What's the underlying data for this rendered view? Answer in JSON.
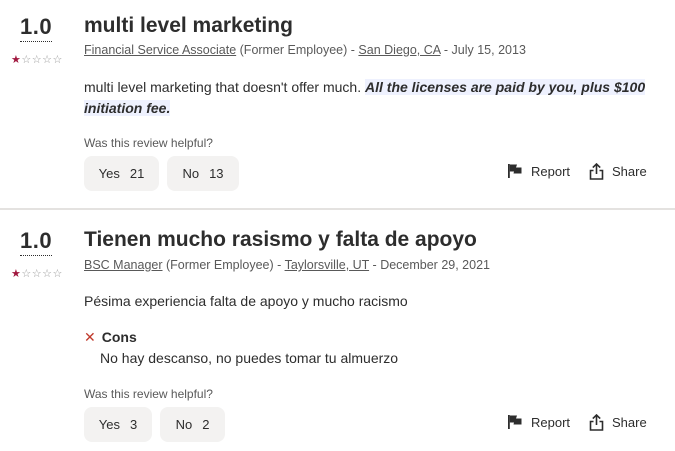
{
  "reviews": [
    {
      "rating": "1.0",
      "stars": 1,
      "title": "multi level marketing",
      "job_title": "Financial Service Associate",
      "employment": "(Former Employee)",
      "location": "San Diego, CA",
      "date": "July 15, 2013",
      "sep1": " - ",
      "sep2": " - ",
      "text": "multi level marketing that doesn't offer much. ",
      "highlight": "All the licenses are paid by you, plus $100 initiation fee.",
      "helpful_label": "Was this review helpful?",
      "yes_label": "Yes",
      "yes_count": "21",
      "no_label": "No",
      "no_count": "13",
      "report_label": "Report",
      "share_label": "Share"
    },
    {
      "rating": "1.0",
      "stars": 1,
      "title": "Tienen mucho rasismo y falta de apoyo",
      "job_title": "BSC Manager",
      "employment": "(Former Employee)",
      "location": "Taylorsville, UT",
      "date": "December 29, 2021",
      "sep1": " - ",
      "sep2": " - ",
      "text": "Pésima experiencia falta de apoyo y mucho racismo",
      "cons_label": "Cons",
      "cons_text": "No hay descanso, no puedes tomar tu almuerzo",
      "helpful_label": "Was this review helpful?",
      "yes_label": "Yes",
      "yes_count": "3",
      "no_label": "No",
      "no_count": "2",
      "report_label": "Report",
      "share_label": "Share"
    }
  ],
  "icons": {
    "star_filled": "star-filled-icon",
    "star_empty": "star-empty-icon",
    "report": "flag-icon",
    "share": "share-icon",
    "cons": "x-icon"
  },
  "colors": {
    "star": "#a0173e",
    "highlight_bg": "#eef1fe",
    "cons_x": "#c0392b",
    "button_bg": "#f3f2f1"
  }
}
